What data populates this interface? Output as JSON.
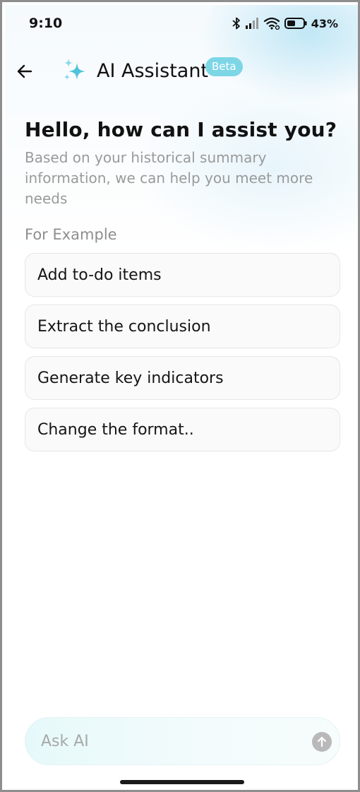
{
  "status_bar": {
    "time": "9:10",
    "battery": "43%"
  },
  "header": {
    "title": "AI Assistant",
    "badge": "Beta"
  },
  "main": {
    "greeting": "Hello, how can I assist you?",
    "subtitle": "Based on your historical summary information, we can help you meet more needs",
    "examples_label": "For Example",
    "suggestions": [
      {
        "label": "Add to-do items"
      },
      {
        "label": "Extract the conclusion"
      },
      {
        "label": "Generate key indicators"
      },
      {
        "label": "Change the format.."
      }
    ]
  },
  "input": {
    "placeholder": "Ask AI",
    "value": ""
  },
  "colors": {
    "accent": "#7dd6e6",
    "sparkle": "#4fc3dc",
    "send_disabled": "#b9b9b9"
  }
}
